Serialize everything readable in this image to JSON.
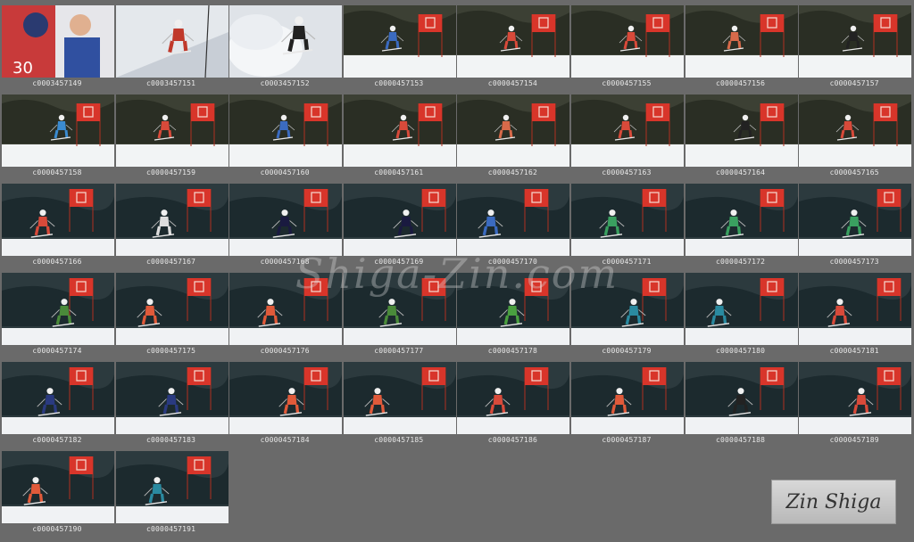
{
  "watermark": "Shiga-Zin.com",
  "signature": "Zin Shiga",
  "colors": {
    "background": "#6a6a6a",
    "caption": "#e8e8e8",
    "gate_flag": "#d8352a",
    "snow": "#f2f4f5"
  },
  "thumbnails": [
    {
      "caption": "c0003457149",
      "scene": "portrait",
      "suit": "#cc2b2b"
    },
    {
      "caption": "c0003457151",
      "scene": "slope",
      "suit": "#c0392b"
    },
    {
      "caption": "c0003457152",
      "scene": "spray",
      "suit": "#222222"
    },
    {
      "caption": "c0000457153",
      "scene": "gate",
      "suit": "#3b6bc0"
    },
    {
      "caption": "c0000457154",
      "scene": "gate",
      "suit": "#d84a3a"
    },
    {
      "caption": "c0000457155",
      "scene": "gate",
      "suit": "#d84a3a"
    },
    {
      "caption": "c0000457156",
      "scene": "gate",
      "suit": "#d86a4a"
    },
    {
      "caption": "c0000457157",
      "scene": "gate",
      "suit": "#222222"
    },
    {
      "caption": "c0000457158",
      "scene": "gate",
      "suit": "#3b8bd0"
    },
    {
      "caption": "c0000457159",
      "scene": "gate",
      "suit": "#d84a3a"
    },
    {
      "caption": "c0000457160",
      "scene": "gate",
      "suit": "#3b6bc0"
    },
    {
      "caption": "c0000457161",
      "scene": "gate",
      "suit": "#d84a3a"
    },
    {
      "caption": "c0000457162",
      "scene": "gate",
      "suit": "#d86a4a"
    },
    {
      "caption": "c0000457163",
      "scene": "gate",
      "suit": "#d84a3a"
    },
    {
      "caption": "c0000457164",
      "scene": "gate",
      "suit": "#222222"
    },
    {
      "caption": "c0000457165",
      "scene": "gate",
      "suit": "#d84a3a"
    },
    {
      "caption": "c0000457166",
      "scene": "dark",
      "suit": "#d84a3a"
    },
    {
      "caption": "c0000457167",
      "scene": "dark",
      "suit": "#dddddd"
    },
    {
      "caption": "c0000457168",
      "scene": "dark",
      "suit": "#1a1a40"
    },
    {
      "caption": "c0000457169",
      "scene": "dark",
      "suit": "#1a1a40"
    },
    {
      "caption": "c0000457170",
      "scene": "dark",
      "suit": "#3b6bc0"
    },
    {
      "caption": "c0000457171",
      "scene": "dark",
      "suit": "#3aa060"
    },
    {
      "caption": "c0000457172",
      "scene": "dark",
      "suit": "#3aa060"
    },
    {
      "caption": "c0000457173",
      "scene": "dark",
      "suit": "#3aa060"
    },
    {
      "caption": "c0000457174",
      "scene": "dark",
      "suit": "#4a8a3a"
    },
    {
      "caption": "c0000457175",
      "scene": "dark",
      "suit": "#e05a3a"
    },
    {
      "caption": "c0000457176",
      "scene": "dark",
      "suit": "#e05a3a"
    },
    {
      "caption": "c0000457177",
      "scene": "dark",
      "suit": "#4a8a3a"
    },
    {
      "caption": "c0000457178",
      "scene": "dark",
      "suit": "#4aa040"
    },
    {
      "caption": "c0000457179",
      "scene": "dark",
      "suit": "#2a8aa0"
    },
    {
      "caption": "c0000457180",
      "scene": "dark",
      "suit": "#2a8aa0"
    },
    {
      "caption": "c0000457181",
      "scene": "dark",
      "suit": "#d84a3a"
    },
    {
      "caption": "c0000457182",
      "scene": "dark",
      "suit": "#2a3a80"
    },
    {
      "caption": "c0000457183",
      "scene": "dark",
      "suit": "#2a3a80"
    },
    {
      "caption": "c0000457184",
      "scene": "dark",
      "suit": "#e05a3a"
    },
    {
      "caption": "c0000457185",
      "scene": "dark",
      "suit": "#e05a3a"
    },
    {
      "caption": "c0000457186",
      "scene": "dark",
      "suit": "#d84a3a"
    },
    {
      "caption": "c0000457187",
      "scene": "dark",
      "suit": "#e05a3a"
    },
    {
      "caption": "c0000457188",
      "scene": "dark",
      "suit": "#222222"
    },
    {
      "caption": "c0000457189",
      "scene": "dark",
      "suit": "#d84a3a"
    },
    {
      "caption": "c0000457190",
      "scene": "dark",
      "suit": "#e05a3a"
    },
    {
      "caption": "c0000457191",
      "scene": "dark",
      "suit": "#2a8aa0"
    }
  ]
}
